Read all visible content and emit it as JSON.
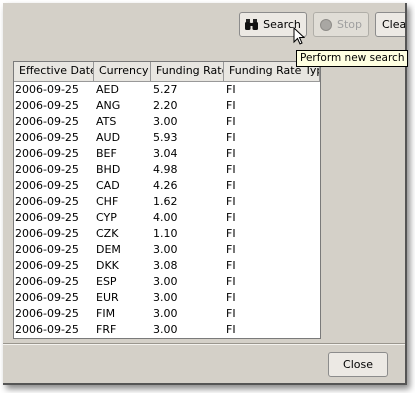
{
  "toolbar": {
    "search_label": "Search",
    "stop_label": "Stop",
    "clear_label": "Clear"
  },
  "tooltip": {
    "text": "Perform new search"
  },
  "table": {
    "columns": [
      "Effective Date",
      "Currency",
      "Funding Rate",
      "Funding Rate Type"
    ],
    "rows": [
      [
        "2006-09-25",
        "AED",
        "5.27",
        "FI"
      ],
      [
        "2006-09-25",
        "ANG",
        "2.20",
        "FI"
      ],
      [
        "2006-09-25",
        "ATS",
        "3.00",
        "FI"
      ],
      [
        "2006-09-25",
        "AUD",
        "5.93",
        "FI"
      ],
      [
        "2006-09-25",
        "BEF",
        "3.04",
        "FI"
      ],
      [
        "2006-09-25",
        "BHD",
        "4.98",
        "FI"
      ],
      [
        "2006-09-25",
        "CAD",
        "4.26",
        "FI"
      ],
      [
        "2006-09-25",
        "CHF",
        "1.62",
        "FI"
      ],
      [
        "2006-09-25",
        "CYP",
        "4.00",
        "FI"
      ],
      [
        "2006-09-25",
        "CZK",
        "1.10",
        "FI"
      ],
      [
        "2006-09-25",
        "DEM",
        "3.00",
        "FI"
      ],
      [
        "2006-09-25",
        "DKK",
        "3.08",
        "FI"
      ],
      [
        "2006-09-25",
        "ESP",
        "3.00",
        "FI"
      ],
      [
        "2006-09-25",
        "EUR",
        "3.00",
        "FI"
      ],
      [
        "2006-09-25",
        "FIM",
        "3.00",
        "FI"
      ],
      [
        "2006-09-25",
        "FRF",
        "3.00",
        "FI"
      ]
    ]
  },
  "footer": {
    "close_label": "Close"
  }
}
